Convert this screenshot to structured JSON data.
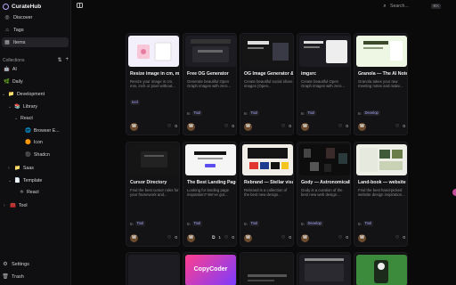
{
  "app": {
    "name": "CurateHub"
  },
  "nav": [
    {
      "label": "Discover",
      "icon": "compass-icon"
    },
    {
      "label": "Tags",
      "icon": "tag-icon"
    },
    {
      "label": "Items",
      "icon": "grid-icon"
    }
  ],
  "collections": {
    "header": "Collections",
    "tree": [
      {
        "label": "AI",
        "emoji": "🤖"
      },
      {
        "label": "Daily",
        "emoji": "🌿"
      },
      {
        "label": "Development",
        "emoji": "📁"
      },
      {
        "label": "Library",
        "emoji": "📚"
      },
      {
        "label": "React",
        "emoji": ""
      },
      {
        "label": "Browser E...",
        "emoji": "🌐"
      },
      {
        "label": "Icon",
        "emoji": "🟠"
      },
      {
        "label": "Shadcn",
        "emoji": "⚫"
      },
      {
        "label": "Saas",
        "emoji": "📁"
      },
      {
        "label": "Template",
        "emoji": "📄"
      },
      {
        "label": "React",
        "emoji": ""
      },
      {
        "label": "Tool",
        "emoji": "🧰"
      }
    ]
  },
  "bottom": {
    "settings": "Settings",
    "trash": "Trash"
  },
  "search": {
    "placeholder": "Search...",
    "shortcut": "⌘K"
  },
  "cards": [
    {
      "title": "Resize image in cm, mm, inch or pixel...",
      "desc": "Resize your image in cm, mm, inch or pixel without...",
      "tags": [
        "tool"
      ],
      "likes": "0",
      "avatar": "W"
    },
    {
      "title": "Free OG Generator",
      "desc": "Generate beautiful Open Graph images with zero...",
      "tags": [
        "In",
        "Tool"
      ],
      "likes": "0",
      "avatar": "W"
    },
    {
      "title": "OG Image Generator & Social Card Make...",
      "desc": "Create beautiful social share images (Open...",
      "tags": [
        "In",
        "Tool"
      ],
      "likes": "0",
      "avatar": "W"
    },
    {
      "title": "imgsrc",
      "desc": "Create beautiful Open Graph images with zero...",
      "tags": [
        "In",
        "Tool"
      ],
      "likes": "0",
      "avatar": "W"
    },
    {
      "title": "Granola — The AI Notepad for meetings",
      "desc": "Granola takes your raw meeting notes and make...",
      "tags": [
        "In",
        "Develop"
      ],
      "likes": "0",
      "avatar": "W"
    },
    {
      "title": "Cursor Directory",
      "desc": "Find the best cursor rules for your framework and...",
      "tags": [
        "In",
        "Tool"
      ],
      "likes": "0",
      "avatar": "W"
    },
    {
      "title": "The Best Landing Page Design...",
      "desc": "Looking for landing page inspiration? We've got...",
      "tags": [
        "In",
        "Tool"
      ],
      "likes": "0",
      "avatar": "W",
      "extra": "1"
    },
    {
      "title": "Rebrand — Stellar visual identity...",
      "desc": "Rebrand is a collection of the best new design...",
      "tags": [
        "In",
        "Tool"
      ],
      "likes": "0",
      "avatar": "W"
    },
    {
      "title": "Gody — Astronomically good...",
      "desc": "Gody is a curation of the best new web design...",
      "tags": [
        "In",
        "Develop"
      ],
      "likes": "0",
      "avatar": "W"
    },
    {
      "title": "Land-book — website design inspiration...",
      "desc": "Find the best hand-picked website design inspiration...",
      "tags": [
        "In",
        "Tool"
      ],
      "likes": "0",
      "avatar": "W"
    },
    {
      "title": "",
      "desc": "",
      "tags": [],
      "likes": "",
      "avatar": ""
    },
    {
      "title": "CopyCoder",
      "desc": "",
      "tags": [],
      "likes": "",
      "avatar": ""
    },
    {
      "title": "",
      "desc": "",
      "tags": [],
      "likes": "",
      "avatar": ""
    },
    {
      "title": "",
      "desc": "",
      "tags": [],
      "likes": "",
      "avatar": ""
    },
    {
      "title": "",
      "desc": "",
      "tags": [],
      "likes": "",
      "avatar": ""
    }
  ],
  "colors": {
    "accent": "#b9a6ff",
    "background": "#0a0a0b",
    "card": "#131316"
  }
}
